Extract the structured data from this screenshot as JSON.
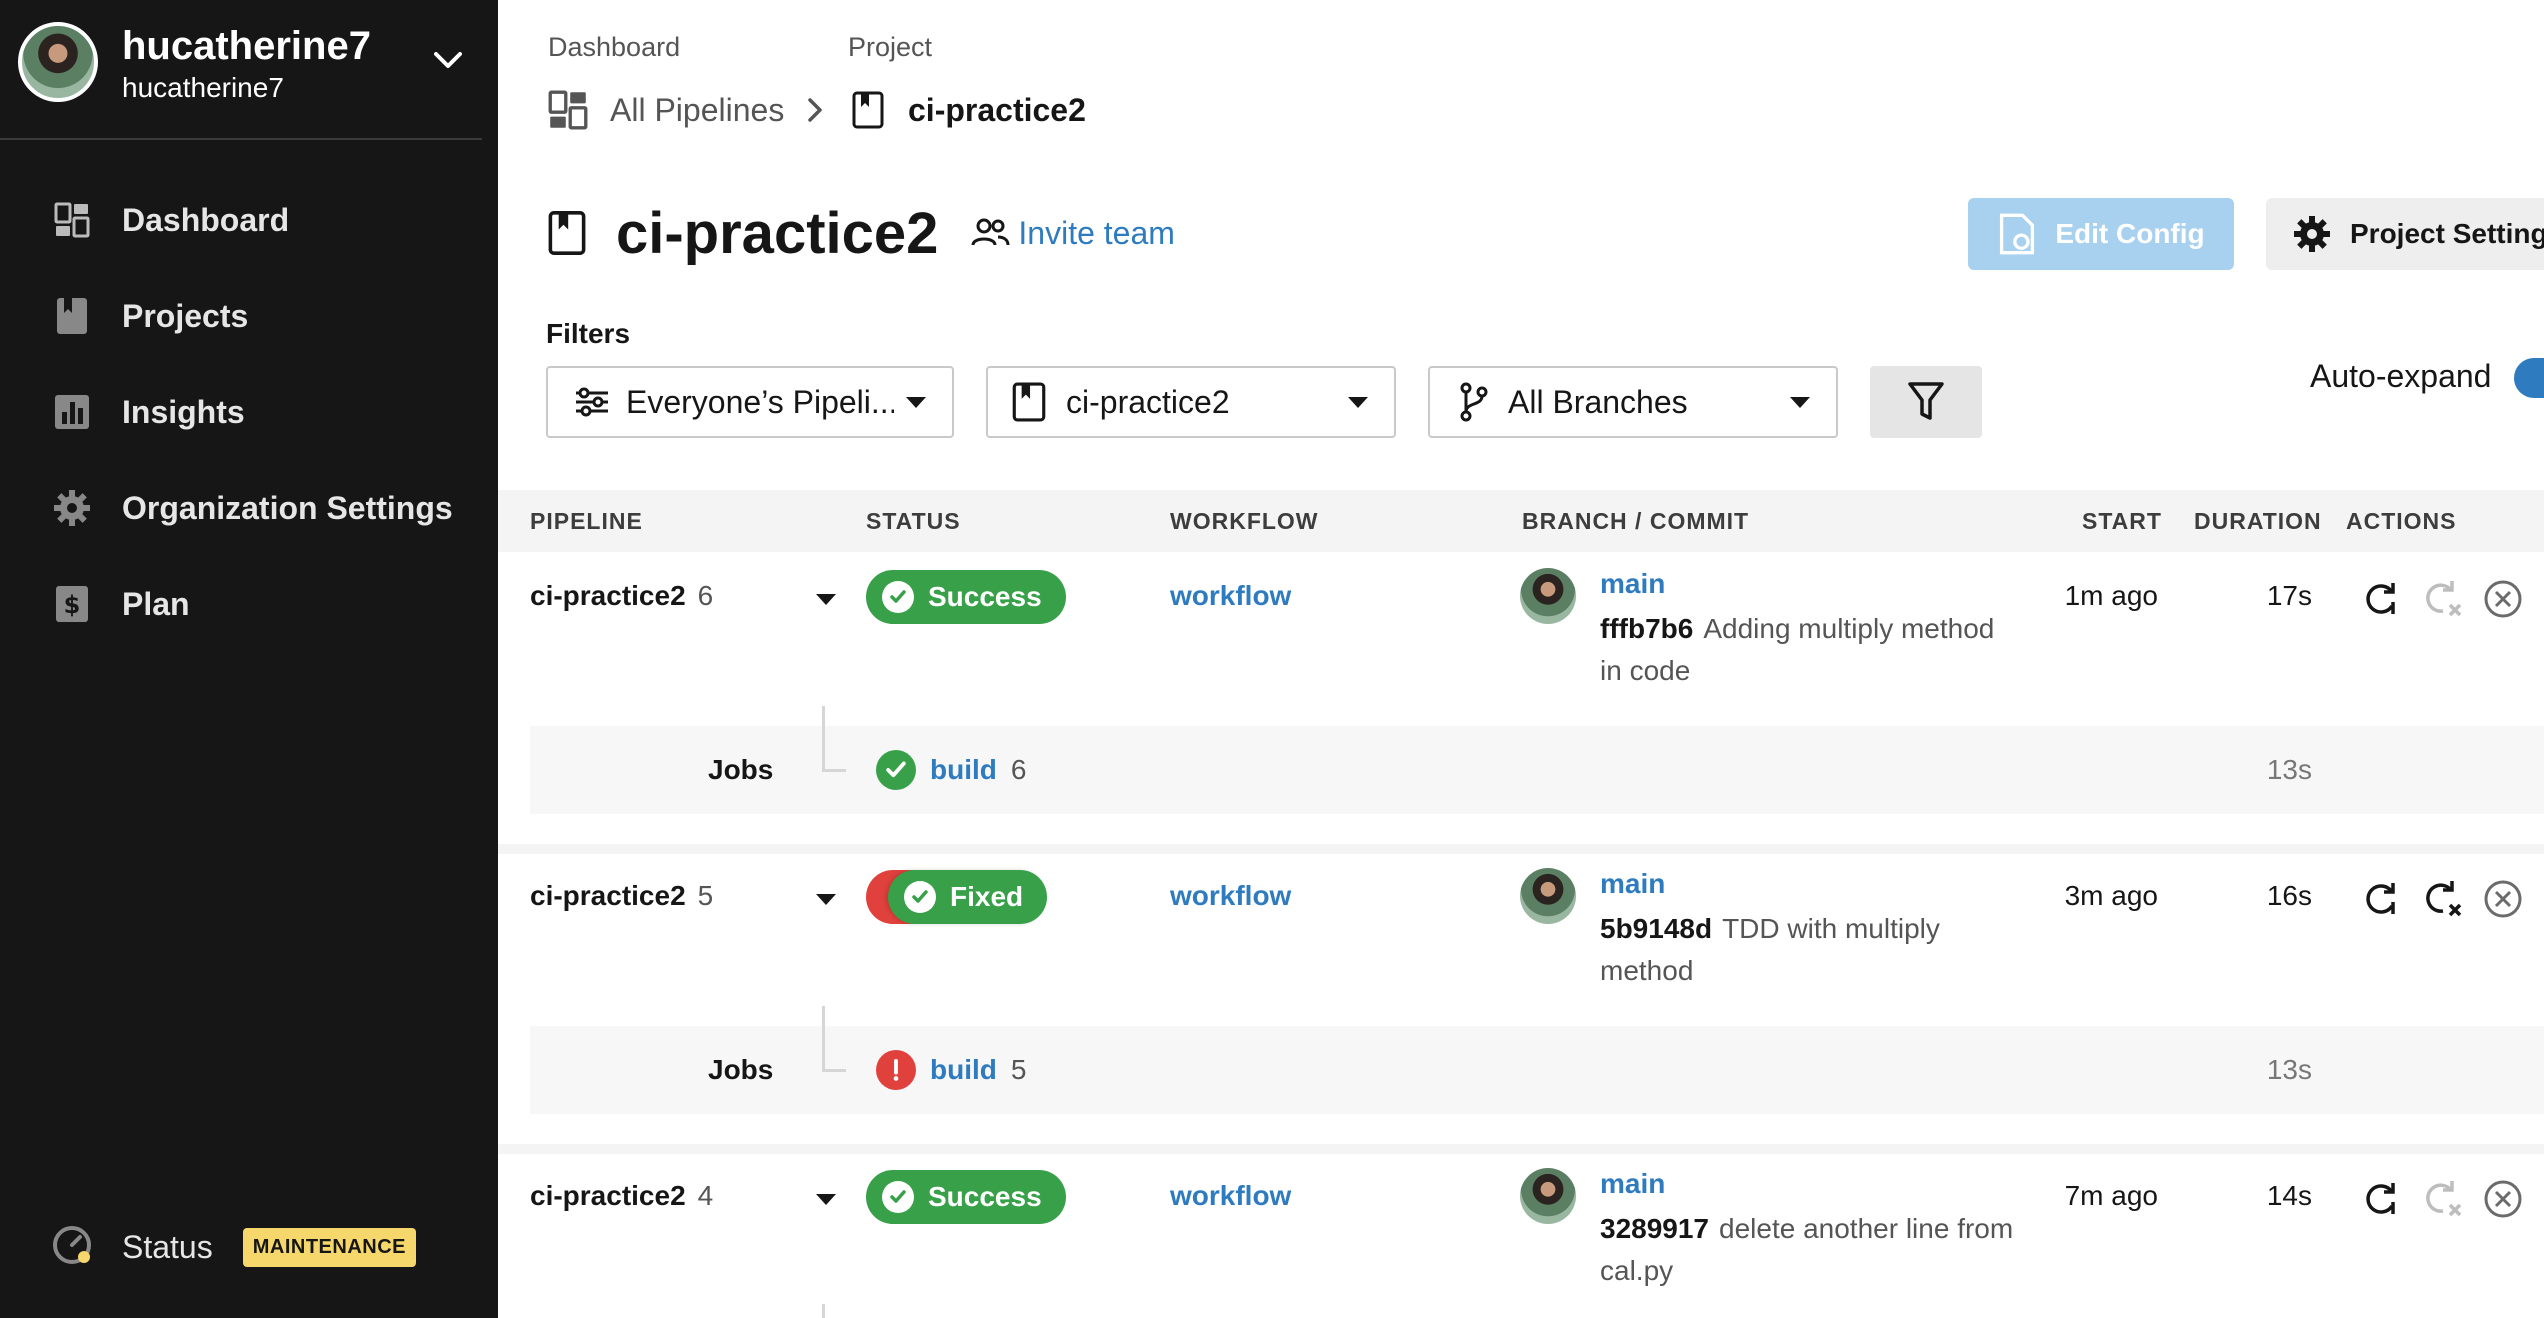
{
  "user": {
    "name": "hucatherine7",
    "org": "hucatherine7"
  },
  "nav": {
    "items": [
      {
        "label": "Dashboard",
        "icon": "dashboard-icon"
      },
      {
        "label": "Projects",
        "icon": "projects-icon"
      },
      {
        "label": "Insights",
        "icon": "insights-icon"
      },
      {
        "label": "Organization Settings",
        "icon": "gear-icon"
      },
      {
        "label": "Plan",
        "icon": "dollar-icon"
      }
    ],
    "status": {
      "label": "Status",
      "badge": "MAINTENANCE"
    }
  },
  "breadcrumb": {
    "dashboard_small": "Dashboard",
    "dashboard_link": "All Pipelines",
    "project_small": "Project",
    "project_link": "ci-practice2"
  },
  "header": {
    "title": "ci-practice2",
    "invite": "Invite team",
    "edit_config": "Edit Config",
    "project_settings": "Project Settings"
  },
  "filters": {
    "label": "Filters",
    "pipelines": "Everyone’s Pipeli...",
    "project": "ci-practice2",
    "branches": "All Branches",
    "auto_expand": "Auto-expand"
  },
  "table": {
    "headers": [
      "PIPELINE",
      "STATUS",
      "WORKFLOW",
      "BRANCH / COMMIT",
      "START",
      "DURATION",
      "ACTIONS"
    ],
    "rows": [
      {
        "project": "ci-practice2",
        "number": "6",
        "status": "Success",
        "workflow": "workflow",
        "branch": "main",
        "sha": "fffb7b6",
        "message": "Adding multiply method in code",
        "start": "1m ago",
        "duration": "17s",
        "jobs_label": "Jobs",
        "job_name": "build",
        "job_number": "6",
        "job_duration": "13s",
        "job_status": "success"
      },
      {
        "project": "ci-practice2",
        "number": "5",
        "status": "Fixed",
        "workflow": "workflow",
        "branch": "main",
        "sha": "5b9148d",
        "message": "TDD with multiply method",
        "start": "3m ago",
        "duration": "16s",
        "jobs_label": "Jobs",
        "job_name": "build",
        "job_number": "5",
        "job_duration": "13s",
        "job_status": "failed"
      },
      {
        "project": "ci-practice2",
        "number": "4",
        "status": "Success",
        "workflow": "workflow",
        "branch": "main",
        "sha": "3289917",
        "message": "delete another line from cal.py",
        "start": "7m ago",
        "duration": "14s"
      }
    ]
  },
  "colors": {
    "success": "#37a049",
    "failed": "#e0413c",
    "link": "#2e7bc0",
    "sidebar": "#161616",
    "maintenance": "#f6d76b"
  }
}
